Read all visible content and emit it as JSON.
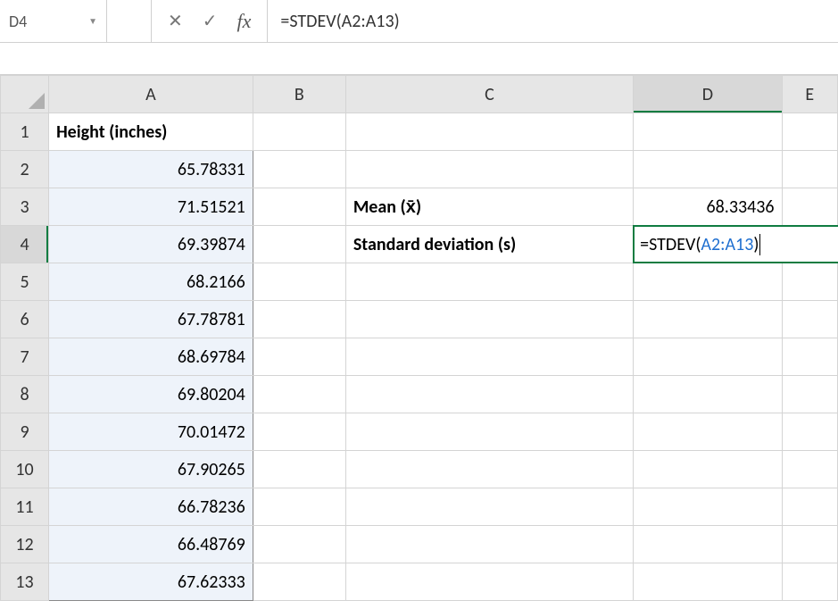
{
  "namebox": {
    "value": "D4"
  },
  "formula_bar": {
    "formula_prefix": "=STDEV(",
    "formula_ref": "A2:A13",
    "formula_suffix": ")"
  },
  "columns": [
    "A",
    "B",
    "C",
    "D",
    "E"
  ],
  "rows": [
    "1",
    "2",
    "3",
    "4",
    "5",
    "6",
    "7",
    "8",
    "9",
    "10",
    "11",
    "12",
    "13"
  ],
  "header_A1": "Height (inches)",
  "heights": [
    "65.78331",
    "71.51521",
    "69.39874",
    "68.2166",
    "67.78781",
    "68.69784",
    "69.80204",
    "70.01472",
    "67.90265",
    "66.78236",
    "66.48769",
    "67.62333"
  ],
  "labels": {
    "mean": "Mean (x̄)",
    "stdev": "Standard deviation (s)"
  },
  "values": {
    "mean": "68.33436"
  },
  "editing_cell": {
    "prefix": "=STDEV(",
    "ref": "A2:A13",
    "suffix": ")"
  },
  "active_cell": "D4",
  "selected_range": "A2:A13"
}
